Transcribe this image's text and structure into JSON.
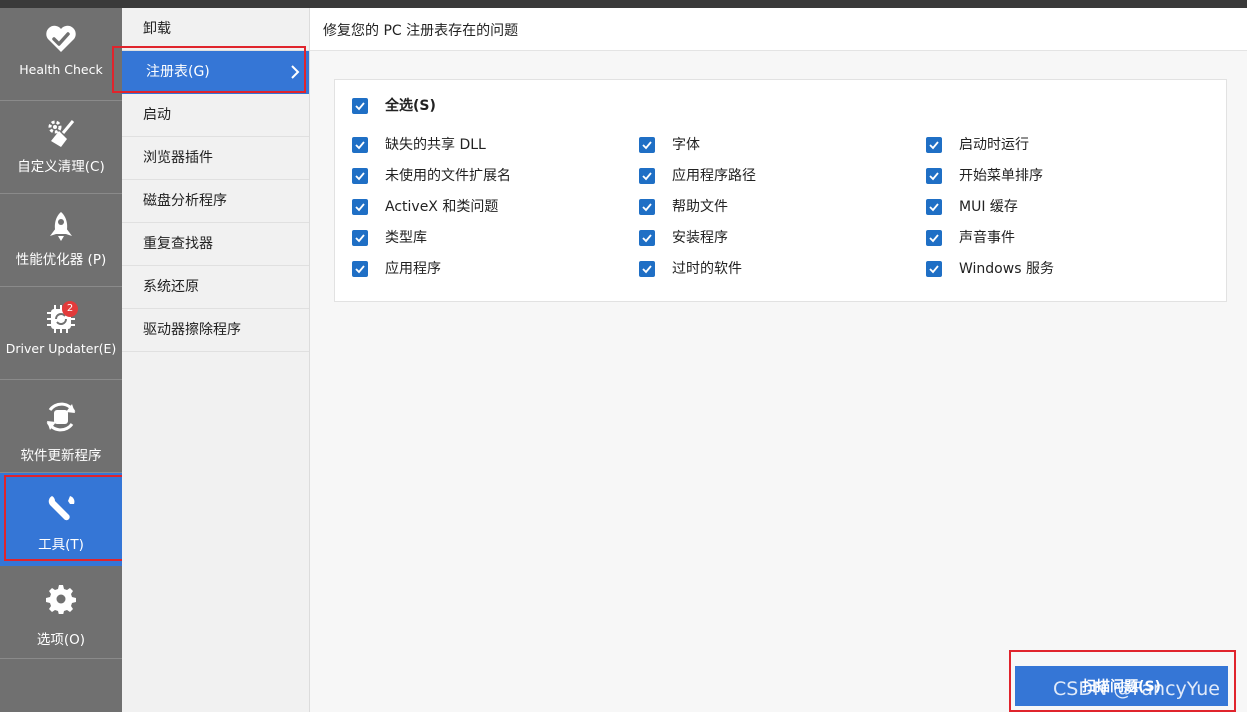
{
  "nav": {
    "items": [
      {
        "label": "Health Check",
        "icon": "heart-icon"
      },
      {
        "label": "自定义清理(C)",
        "icon": "broom-icon"
      },
      {
        "label": "性能优化器 (P)",
        "icon": "rocket-icon"
      },
      {
        "label": "Driver Updater(E)",
        "icon": "chip-icon",
        "badge": "2"
      },
      {
        "label": "软件更新程序",
        "icon": "update-icon"
      },
      {
        "label": "工具(T)",
        "icon": "wrench-icon",
        "active": true
      },
      {
        "label": "选项(O)",
        "icon": "gear-icon"
      }
    ]
  },
  "submenu": {
    "items": [
      {
        "label": "卸载"
      },
      {
        "label": "注册表(G)",
        "active": true
      },
      {
        "label": "启动"
      },
      {
        "label": "浏览器插件"
      },
      {
        "label": "磁盘分析程序"
      },
      {
        "label": "重复查找器"
      },
      {
        "label": "系统还原"
      },
      {
        "label": "驱动器擦除程序"
      }
    ]
  },
  "main": {
    "title": "修复您的 PC 注册表存在的问题",
    "select_all": {
      "label": "全选(S)",
      "checked": true
    },
    "options": [
      {
        "label": "缺失的共享 DLL",
        "checked": true
      },
      {
        "label": "字体",
        "checked": true
      },
      {
        "label": "启动时运行",
        "checked": true
      },
      {
        "label": "未使用的文件扩展名",
        "checked": true
      },
      {
        "label": "应用程序路径",
        "checked": true
      },
      {
        "label": "开始菜单排序",
        "checked": true
      },
      {
        "label": "ActiveX 和类问题",
        "checked": true
      },
      {
        "label": "帮助文件",
        "checked": true
      },
      {
        "label": "MUI 缓存",
        "checked": true
      },
      {
        "label": "类型库",
        "checked": true
      },
      {
        "label": "安装程序",
        "checked": true
      },
      {
        "label": "声音事件",
        "checked": true
      },
      {
        "label": "应用程序",
        "checked": true
      },
      {
        "label": "过时的软件",
        "checked": true
      },
      {
        "label": "Windows 服务",
        "checked": true
      }
    ],
    "scan_button": "扫描问题(S)"
  },
  "watermark": "CSDN @FancyYue",
  "colors": {
    "accent": "#3576d6",
    "checkbox": "#1f6fc5",
    "nav_bg": "#707070",
    "highlight": "#e0242c"
  }
}
